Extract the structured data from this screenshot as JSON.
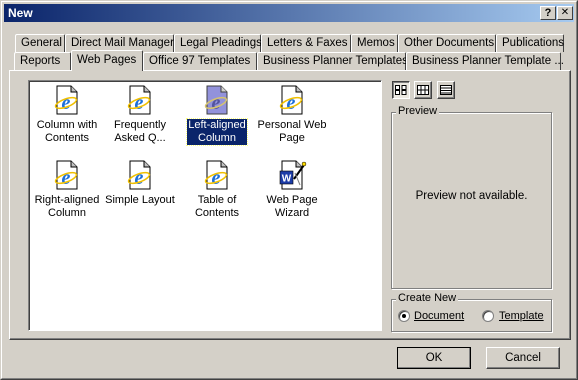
{
  "window": {
    "title": "New",
    "help_btn": "?",
    "close_btn": "✕"
  },
  "tabs_row1": [
    "General",
    "Direct Mail Manager",
    "Legal Pleadings",
    "Letters & Faxes",
    "Memos",
    "Other Documents",
    "Publications"
  ],
  "tabs_row2": [
    "Reports",
    "Web Pages",
    "Office 97 Templates",
    "Business Planner Templates",
    "Business Planner Template ..."
  ],
  "active_tab": "Web Pages",
  "items": [
    {
      "line1": "Column with",
      "line2": "Contents",
      "icon": "ie-document-icon",
      "selected": false
    },
    {
      "line1": "Frequently",
      "line2": "Asked Q...",
      "icon": "ie-document-icon",
      "selected": false
    },
    {
      "line1": "Left-aligned",
      "line2": "Column",
      "icon": "ie-document-icon",
      "selected": true
    },
    {
      "line1": "Personal Web",
      "line2": "Page",
      "icon": "ie-document-icon",
      "selected": false
    },
    {
      "line1": "Right-aligned",
      "line2": "Column",
      "icon": "ie-document-icon",
      "selected": false
    },
    {
      "line1": "Simple Layout",
      "line2": "",
      "icon": "ie-document-icon",
      "selected": false
    },
    {
      "line1": "Table of",
      "line2": "Contents",
      "icon": "ie-document-icon",
      "selected": false
    },
    {
      "line1": "Web Page",
      "line2": "Wizard",
      "icon": "word-wizard-icon",
      "selected": false
    }
  ],
  "view_buttons": [
    {
      "name": "large-icons-view-icon",
      "active": true
    },
    {
      "name": "list-view-icon",
      "active": false
    },
    {
      "name": "details-view-icon",
      "active": false
    }
  ],
  "preview": {
    "label": "Preview",
    "message": "Preview not available."
  },
  "create_new": {
    "label": "Create New",
    "document_label": "Document",
    "template_label": "Template",
    "selected": "Document"
  },
  "buttons": {
    "ok": "OK",
    "cancel": "Cancel"
  }
}
